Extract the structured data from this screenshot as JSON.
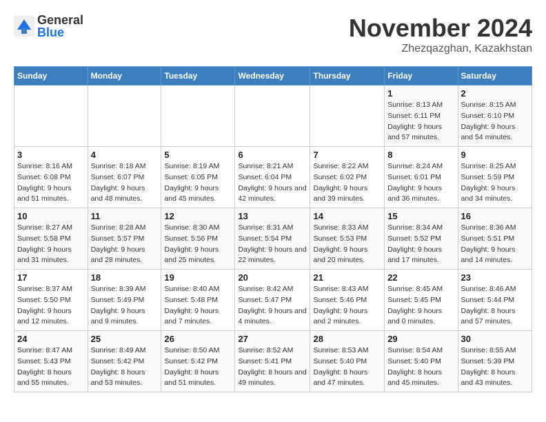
{
  "logo": {
    "general": "General",
    "blue": "Blue"
  },
  "title": "November 2024",
  "location": "Zhezqazghan, Kazakhstan",
  "days_header": [
    "Sunday",
    "Monday",
    "Tuesday",
    "Wednesday",
    "Thursday",
    "Friday",
    "Saturday"
  ],
  "weeks": [
    [
      {
        "day": "",
        "info": ""
      },
      {
        "day": "",
        "info": ""
      },
      {
        "day": "",
        "info": ""
      },
      {
        "day": "",
        "info": ""
      },
      {
        "day": "",
        "info": ""
      },
      {
        "day": "1",
        "info": "Sunrise: 8:13 AM\nSunset: 6:11 PM\nDaylight: 9 hours and 57 minutes."
      },
      {
        "day": "2",
        "info": "Sunrise: 8:15 AM\nSunset: 6:10 PM\nDaylight: 9 hours and 54 minutes."
      }
    ],
    [
      {
        "day": "3",
        "info": "Sunrise: 8:16 AM\nSunset: 6:08 PM\nDaylight: 9 hours and 51 minutes."
      },
      {
        "day": "4",
        "info": "Sunrise: 8:18 AM\nSunset: 6:07 PM\nDaylight: 9 hours and 48 minutes."
      },
      {
        "day": "5",
        "info": "Sunrise: 8:19 AM\nSunset: 6:05 PM\nDaylight: 9 hours and 45 minutes."
      },
      {
        "day": "6",
        "info": "Sunrise: 8:21 AM\nSunset: 6:04 PM\nDaylight: 9 hours and 42 minutes."
      },
      {
        "day": "7",
        "info": "Sunrise: 8:22 AM\nSunset: 6:02 PM\nDaylight: 9 hours and 39 minutes."
      },
      {
        "day": "8",
        "info": "Sunrise: 8:24 AM\nSunset: 6:01 PM\nDaylight: 9 hours and 36 minutes."
      },
      {
        "day": "9",
        "info": "Sunrise: 8:25 AM\nSunset: 5:59 PM\nDaylight: 9 hours and 34 minutes."
      }
    ],
    [
      {
        "day": "10",
        "info": "Sunrise: 8:27 AM\nSunset: 5:58 PM\nDaylight: 9 hours and 31 minutes."
      },
      {
        "day": "11",
        "info": "Sunrise: 8:28 AM\nSunset: 5:57 PM\nDaylight: 9 hours and 28 minutes."
      },
      {
        "day": "12",
        "info": "Sunrise: 8:30 AM\nSunset: 5:56 PM\nDaylight: 9 hours and 25 minutes."
      },
      {
        "day": "13",
        "info": "Sunrise: 8:31 AM\nSunset: 5:54 PM\nDaylight: 9 hours and 22 minutes."
      },
      {
        "day": "14",
        "info": "Sunrise: 8:33 AM\nSunset: 5:53 PM\nDaylight: 9 hours and 20 minutes."
      },
      {
        "day": "15",
        "info": "Sunrise: 8:34 AM\nSunset: 5:52 PM\nDaylight: 9 hours and 17 minutes."
      },
      {
        "day": "16",
        "info": "Sunrise: 8:36 AM\nSunset: 5:51 PM\nDaylight: 9 hours and 14 minutes."
      }
    ],
    [
      {
        "day": "17",
        "info": "Sunrise: 8:37 AM\nSunset: 5:50 PM\nDaylight: 9 hours and 12 minutes."
      },
      {
        "day": "18",
        "info": "Sunrise: 8:39 AM\nSunset: 5:49 PM\nDaylight: 9 hours and 9 minutes."
      },
      {
        "day": "19",
        "info": "Sunrise: 8:40 AM\nSunset: 5:48 PM\nDaylight: 9 hours and 7 minutes."
      },
      {
        "day": "20",
        "info": "Sunrise: 8:42 AM\nSunset: 5:47 PM\nDaylight: 9 hours and 4 minutes."
      },
      {
        "day": "21",
        "info": "Sunrise: 8:43 AM\nSunset: 5:46 PM\nDaylight: 9 hours and 2 minutes."
      },
      {
        "day": "22",
        "info": "Sunrise: 8:45 AM\nSunset: 5:45 PM\nDaylight: 9 hours and 0 minutes."
      },
      {
        "day": "23",
        "info": "Sunrise: 8:46 AM\nSunset: 5:44 PM\nDaylight: 8 hours and 57 minutes."
      }
    ],
    [
      {
        "day": "24",
        "info": "Sunrise: 8:47 AM\nSunset: 5:43 PM\nDaylight: 8 hours and 55 minutes."
      },
      {
        "day": "25",
        "info": "Sunrise: 8:49 AM\nSunset: 5:42 PM\nDaylight: 8 hours and 53 minutes."
      },
      {
        "day": "26",
        "info": "Sunrise: 8:50 AM\nSunset: 5:42 PM\nDaylight: 8 hours and 51 minutes."
      },
      {
        "day": "27",
        "info": "Sunrise: 8:52 AM\nSunset: 5:41 PM\nDaylight: 8 hours and 49 minutes."
      },
      {
        "day": "28",
        "info": "Sunrise: 8:53 AM\nSunset: 5:40 PM\nDaylight: 8 hours and 47 minutes."
      },
      {
        "day": "29",
        "info": "Sunrise: 8:54 AM\nSunset: 5:40 PM\nDaylight: 8 hours and 45 minutes."
      },
      {
        "day": "30",
        "info": "Sunrise: 8:55 AM\nSunset: 5:39 PM\nDaylight: 8 hours and 43 minutes."
      }
    ]
  ]
}
